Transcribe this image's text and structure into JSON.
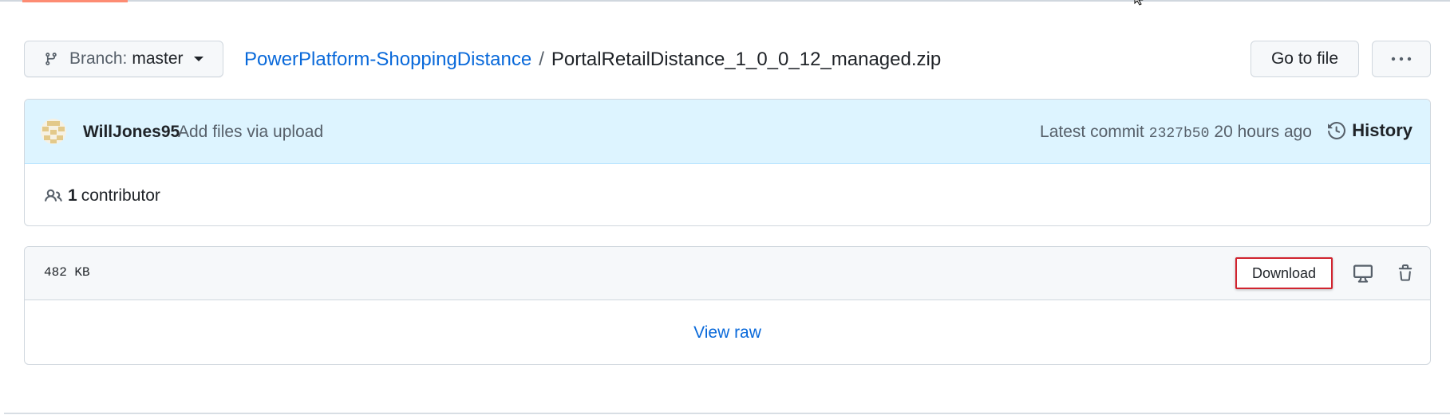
{
  "branch": {
    "label": "Branch:",
    "name": "master"
  },
  "breadcrumb": {
    "repo": "PowerPlatform-ShoppingDistance",
    "separator": "/",
    "file": "PortalRetailDistance_1_0_0_12_managed.zip"
  },
  "actions": {
    "goto_file": "Go to file"
  },
  "commit": {
    "author": "WillJones95",
    "message": "Add files via upload",
    "latest_label": "Latest commit",
    "sha": "2327b50",
    "time": "20 hours ago",
    "history_label": "History"
  },
  "contributors": {
    "count": "1",
    "label": "contributor"
  },
  "file": {
    "size": "482 KB",
    "download_label": "Download",
    "view_raw_label": "View raw"
  },
  "colors": {
    "link": "#0969da",
    "accent_underline": "#fd8c73",
    "commit_bg": "#ddf4ff",
    "highlight_border": "#d1242f"
  }
}
